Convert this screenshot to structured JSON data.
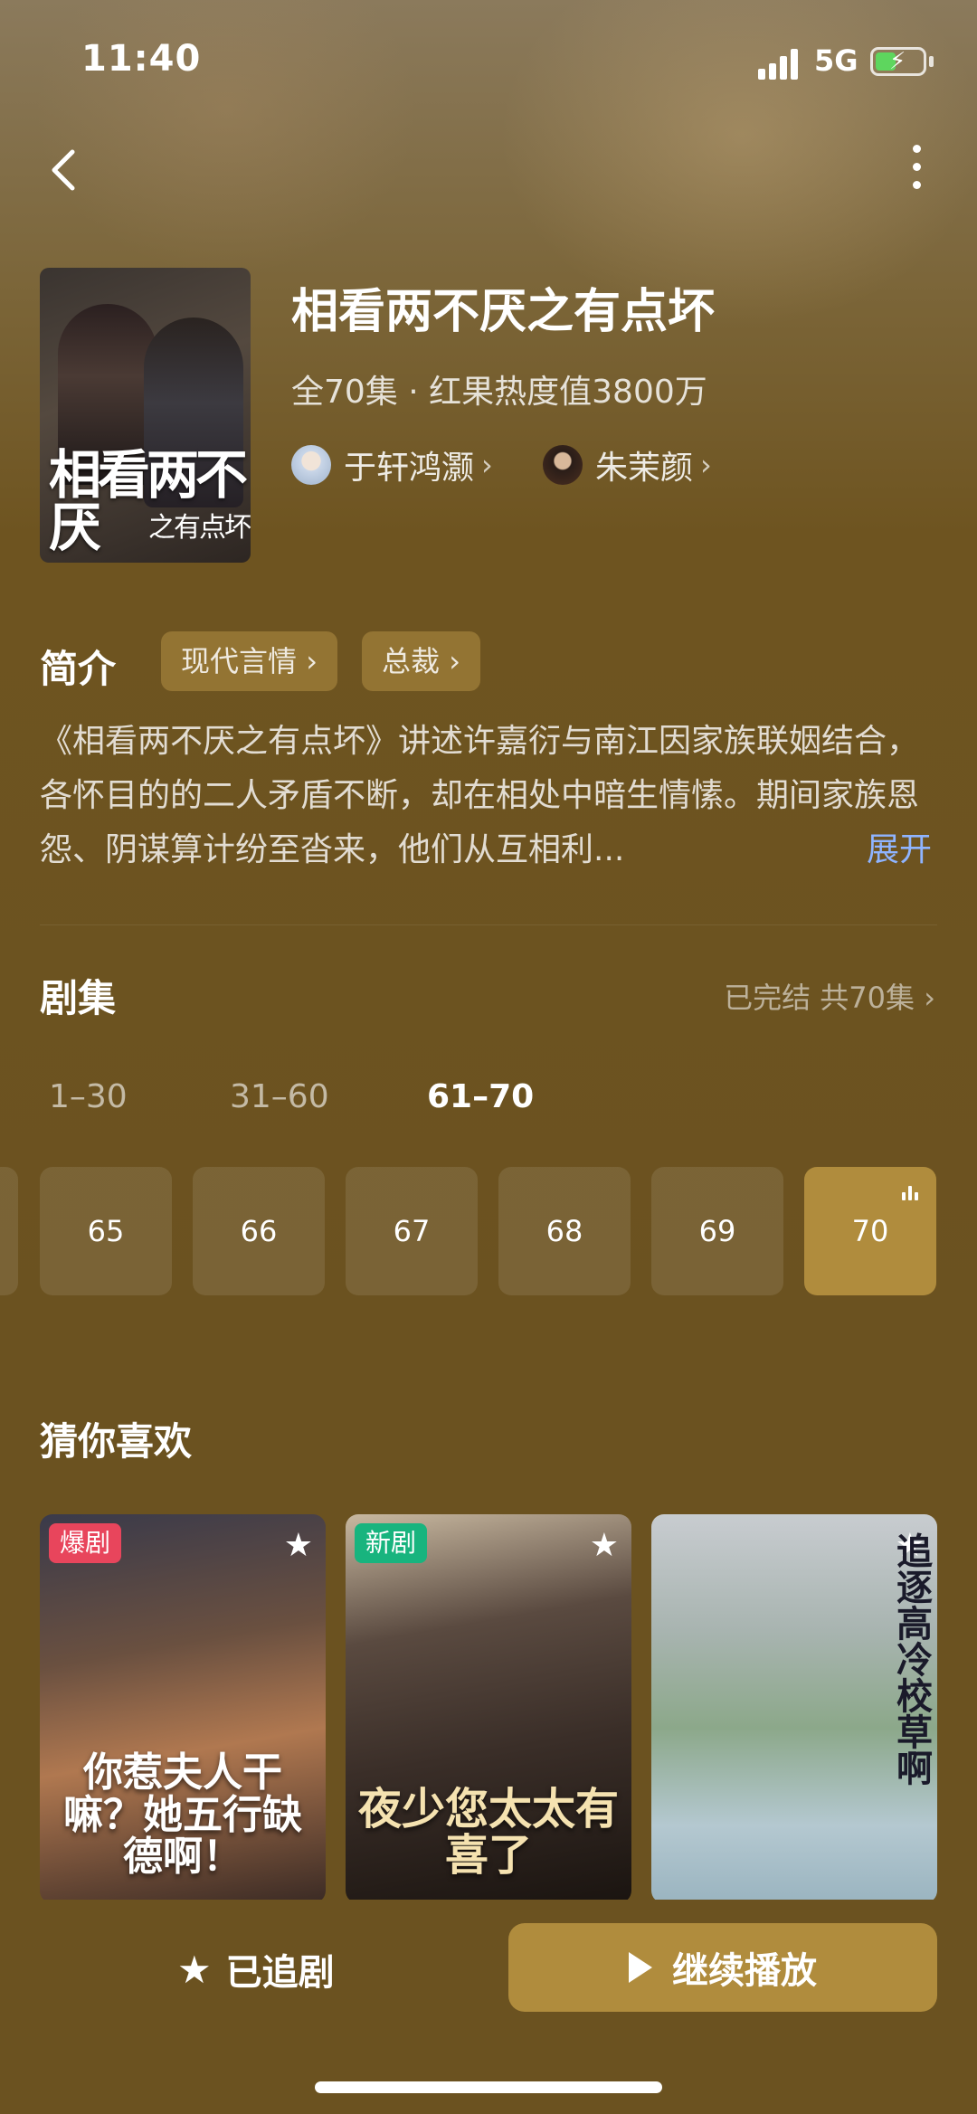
{
  "status_bar": {
    "time": "11:40",
    "network": "5G"
  },
  "show": {
    "title": "相看两不厌之有点坏",
    "meta": "全70集 · 红果热度值3800万",
    "poster_title": "相看两不厌",
    "poster_subtitle": "之有点坏",
    "cast": [
      {
        "name": "于轩鸿灏"
      },
      {
        "name": "朱茉颜"
      }
    ]
  },
  "intro": {
    "heading": "简介",
    "tags": [
      "现代言情",
      "总裁"
    ],
    "text": "《相看两不厌之有点坏》讲述许嘉衍与南江因家族联姻结合，各怀目的的二人矛盾不断，却在相处中暗生情愫。期间家族恩怨、阴谋算计纷至沓来，他们从互相利...",
    "expand_label": "展开"
  },
  "episodes": {
    "heading": "剧集",
    "status": "已完结 共70集",
    "ranges": [
      "1–30",
      "31–60",
      "61–70"
    ],
    "active_range": "61–70",
    "visible": [
      "65",
      "66",
      "67",
      "68",
      "69",
      "70"
    ],
    "current": "70"
  },
  "recommend": {
    "heading": "猜你喜欢",
    "items": [
      {
        "badge": "爆剧",
        "title": "你惹夫人干嘛？她五行缺德啊！"
      },
      {
        "badge": "新剧",
        "title": "夜少您太太有喜了"
      },
      {
        "badge": "",
        "title": "追逐高冷校草啊"
      }
    ]
  },
  "actions": {
    "follow_label": "已追剧",
    "play_label": "继续播放"
  },
  "colors": {
    "background": "#6b5220",
    "accent": "#b08c3d",
    "link": "#8fb4ff",
    "hot_badge": "#e8455c",
    "new_badge": "#18b47e"
  }
}
